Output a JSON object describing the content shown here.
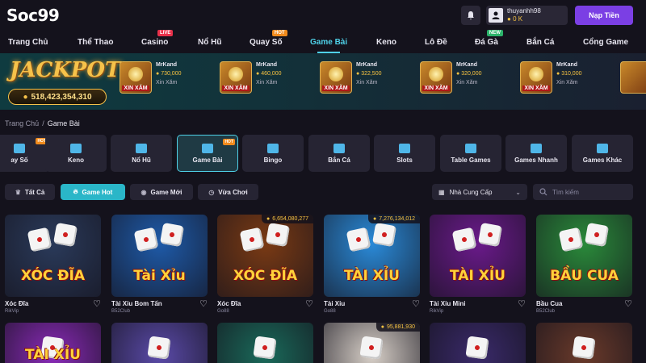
{
  "header": {
    "logo": "Soc99",
    "username": "thuyanhh98",
    "balance": "0 K",
    "deposit_label": "Nạp Tiền"
  },
  "nav": [
    {
      "label": "Trang Chủ",
      "badge": ""
    },
    {
      "label": "Thể Thao",
      "badge": ""
    },
    {
      "label": "Casino",
      "badge": "LIVE"
    },
    {
      "label": "Nổ Hũ",
      "badge": ""
    },
    {
      "label": "Quay Số",
      "badge": "HOT"
    },
    {
      "label": "Game Bài",
      "badge": ""
    },
    {
      "label": "Keno",
      "badge": ""
    },
    {
      "label": "Lô Đề",
      "badge": ""
    },
    {
      "label": "Đá Gà",
      "badge": "NEW"
    },
    {
      "label": "Bắn Cá",
      "badge": ""
    },
    {
      "label": "Cổng Game",
      "badge": ""
    }
  ],
  "jackpot": {
    "title": "JACKPOT",
    "amount": "518,423,354,310",
    "winners": [
      {
        "name": "MrKand",
        "value": "730,000",
        "game": "Xin Xăm",
        "thumb_label": "XIN XĂM"
      },
      {
        "name": "MrKand",
        "value": "460,000",
        "game": "Xin Xăm",
        "thumb_label": "XIN XĂM"
      },
      {
        "name": "MrKand",
        "value": "322,500",
        "game": "Xin Xăm",
        "thumb_label": "XIN XĂM"
      },
      {
        "name": "MrKand",
        "value": "320,000",
        "game": "Xin Xăm",
        "thumb_label": "XIN XĂM"
      },
      {
        "name": "MrKand",
        "value": "310,000",
        "game": "Xin Xăm",
        "thumb_label": "XIN XĂM"
      }
    ]
  },
  "breadcrumb": {
    "home": "Trang Chủ",
    "sep": "/",
    "current": "Game Bài"
  },
  "categories": [
    {
      "label": "ay Số",
      "hot": "HOT"
    },
    {
      "label": "Keno",
      "hot": ""
    },
    {
      "label": "Nổ Hũ",
      "hot": ""
    },
    {
      "label": "Game Bài",
      "hot": "HOT"
    },
    {
      "label": "Bingo",
      "hot": ""
    },
    {
      "label": "Bắn Cá",
      "hot": ""
    },
    {
      "label": "Slots",
      "hot": ""
    },
    {
      "label": "Table Games",
      "hot": ""
    },
    {
      "label": "Games Nhanh",
      "hot": ""
    },
    {
      "label": "Games Khác",
      "hot": ""
    }
  ],
  "filters": {
    "all": "Tất Cả",
    "hot": "Game Hot",
    "new": "Game Mới",
    "recent": "Vừa Chơi",
    "provider": "Nhà Cung Cấp",
    "search_placeholder": "Tìm kiếm"
  },
  "games": [
    {
      "name": "Xóc Đĩa",
      "provider": "RikVip",
      "title": "XÓC ĐĨA",
      "jackpot": "",
      "bg": "#2a3a5a"
    },
    {
      "name": "Tài Xỉu Bom Tấn",
      "provider": "B52Club",
      "title": "Tài Xỉu",
      "jackpot": "",
      "bg": "#1e5aa8"
    },
    {
      "name": "Xóc Đĩa",
      "provider": "Go88",
      "title": "XÓC ĐĨA",
      "jackpot": "6,654,080,277",
      "bg": "#7a3a14"
    },
    {
      "name": "Tài Xỉu",
      "provider": "Go88",
      "title": "TÀI XỈU",
      "jackpot": "7,276,134,012",
      "bg": "#2a8ad8"
    },
    {
      "name": "Tài Xỉu Mini",
      "provider": "RikVip",
      "title": "TÀI XỈU",
      "jackpot": "",
      "bg": "#6a1a8a"
    },
    {
      "name": "Bầu Cua",
      "provider": "B52Club",
      "title": "BẦU CUA",
      "jackpot": "",
      "bg": "#2a8a3a"
    }
  ],
  "games_row2": [
    {
      "title": "TÀI XỈU",
      "jackpot": "",
      "bg": "#8a2ab8"
    },
    {
      "title": "",
      "jackpot": "",
      "bg": "#5a4aa8"
    },
    {
      "title": "",
      "jackpot": "",
      "bg": "#1a6a5a"
    },
    {
      "title": "",
      "jackpot": "95,881,930",
      "bg": "#d8d0c8"
    },
    {
      "title": "",
      "jackpot": "",
      "bg": "#3a2a6a"
    },
    {
      "title": "",
      "jackpot": "",
      "bg": "#6a3a2a"
    }
  ],
  "colors": {
    "accent": "#4fd1e8",
    "deposit": "#7b3fe4",
    "gold": "#f5c242",
    "bg": "#14121c"
  }
}
